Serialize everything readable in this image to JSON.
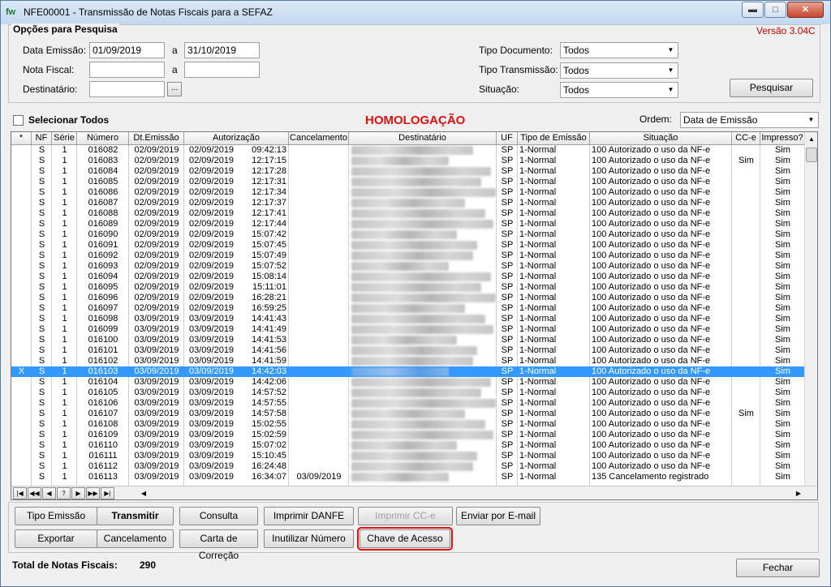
{
  "window": {
    "app_icon": "fw",
    "title": "NFE00001 - Transmissão de Notas Fiscais para a SEFAZ",
    "minimize": "▬",
    "maximize": "□",
    "close": "✕"
  },
  "options": {
    "legend": "Opções para Pesquisa",
    "version": "Versão 3.04C",
    "data_emissao_label": "Data Emissão:",
    "data_emissao_from": "01/09/2019",
    "data_emissao_to": "31/10/2019",
    "range_sep": "a",
    "nota_fiscal_label": "Nota Fiscal:",
    "nota_fiscal_from": "",
    "nota_fiscal_to": "",
    "destinatario_label": "Destinatário:",
    "destinatario_value": "",
    "lookup_button": "...",
    "tipo_documento_label": "Tipo Documento:",
    "tipo_documento_value": "Todos",
    "tipo_transmissao_label": "Tipo Transmissão:",
    "tipo_transmissao_value": "Todos",
    "situacao_label": "Situação:",
    "situacao_value": "Todos",
    "pesquisar_button": "Pesquisar"
  },
  "list_controls": {
    "select_all_label": "Selecionar Todos",
    "environment": "HOMOLOGAÇÃO",
    "ordem_label": "Ordem:",
    "ordem_value": "Data de Emissão"
  },
  "grid": {
    "columns": [
      "*",
      "NF",
      "Série",
      "Número",
      "Dt.Emissão",
      "Autorização",
      "Cancelamento",
      "Destinatário",
      "UF",
      "Tipo de Emissão",
      "Situação",
      "CC-e",
      "Impresso?"
    ],
    "rows": [
      {
        "mark": "",
        "nf": "S",
        "serie": "1",
        "numero": "016082",
        "emissao": "02/09/2019",
        "aut_data": "02/09/2019",
        "aut_hora": "09:42:13",
        "cancel": "",
        "uf": "SP",
        "tipo": "1-Normal",
        "situacao": "100 Autorizado o uso da NF-e",
        "cce": "",
        "impresso": "Sim"
      },
      {
        "mark": "",
        "nf": "S",
        "serie": "1",
        "numero": "016083",
        "emissao": "02/09/2019",
        "aut_data": "02/09/2019",
        "aut_hora": "12:17:15",
        "cancel": "",
        "uf": "SP",
        "tipo": "1-Normal",
        "situacao": "100 Autorizado o uso da NF-e",
        "cce": "Sim",
        "impresso": "Sim"
      },
      {
        "mark": "",
        "nf": "S",
        "serie": "1",
        "numero": "016084",
        "emissao": "02/09/2019",
        "aut_data": "02/09/2019",
        "aut_hora": "12:17:28",
        "cancel": "",
        "uf": "SP",
        "tipo": "1-Normal",
        "situacao": "100 Autorizado o uso da NF-e",
        "cce": "",
        "impresso": "Sim"
      },
      {
        "mark": "",
        "nf": "S",
        "serie": "1",
        "numero": "016085",
        "emissao": "02/09/2019",
        "aut_data": "02/09/2019",
        "aut_hora": "12:17:31",
        "cancel": "",
        "uf": "SP",
        "tipo": "1-Normal",
        "situacao": "100 Autorizado o uso da NF-e",
        "cce": "",
        "impresso": "Sim"
      },
      {
        "mark": "",
        "nf": "S",
        "serie": "1",
        "numero": "016086",
        "emissao": "02/09/2019",
        "aut_data": "02/09/2019",
        "aut_hora": "12:17:34",
        "cancel": "",
        "uf": "SP",
        "tipo": "1-Normal",
        "situacao": "100 Autorizado o uso da NF-e",
        "cce": "",
        "impresso": "Sim"
      },
      {
        "mark": "",
        "nf": "S",
        "serie": "1",
        "numero": "016087",
        "emissao": "02/09/2019",
        "aut_data": "02/09/2019",
        "aut_hora": "12:17:37",
        "cancel": "",
        "uf": "SP",
        "tipo": "1-Normal",
        "situacao": "100 Autorizado o uso da NF-e",
        "cce": "",
        "impresso": "Sim"
      },
      {
        "mark": "",
        "nf": "S",
        "serie": "1",
        "numero": "016088",
        "emissao": "02/09/2019",
        "aut_data": "02/09/2019",
        "aut_hora": "12:17:41",
        "cancel": "",
        "uf": "SP",
        "tipo": "1-Normal",
        "situacao": "100 Autorizado o uso da NF-e",
        "cce": "",
        "impresso": "Sim"
      },
      {
        "mark": "",
        "nf": "S",
        "serie": "1",
        "numero": "016089",
        "emissao": "02/09/2019",
        "aut_data": "02/09/2019",
        "aut_hora": "12:17:44",
        "cancel": "",
        "uf": "SP",
        "tipo": "1-Normal",
        "situacao": "100 Autorizado o uso da NF-e",
        "cce": "",
        "impresso": "Sim"
      },
      {
        "mark": "",
        "nf": "S",
        "serie": "1",
        "numero": "016090",
        "emissao": "02/09/2019",
        "aut_data": "02/09/2019",
        "aut_hora": "15:07:42",
        "cancel": "",
        "uf": "SP",
        "tipo": "1-Normal",
        "situacao": "100 Autorizado o uso da NF-e",
        "cce": "",
        "impresso": "Sim"
      },
      {
        "mark": "",
        "nf": "S",
        "serie": "1",
        "numero": "016091",
        "emissao": "02/09/2019",
        "aut_data": "02/09/2019",
        "aut_hora": "15:07:45",
        "cancel": "",
        "uf": "SP",
        "tipo": "1-Normal",
        "situacao": "100 Autorizado o uso da NF-e",
        "cce": "",
        "impresso": "Sim"
      },
      {
        "mark": "",
        "nf": "S",
        "serie": "1",
        "numero": "016092",
        "emissao": "02/09/2019",
        "aut_data": "02/09/2019",
        "aut_hora": "15:07:49",
        "cancel": "",
        "uf": "SP",
        "tipo": "1-Normal",
        "situacao": "100 Autorizado o uso da NF-e",
        "cce": "",
        "impresso": "Sim"
      },
      {
        "mark": "",
        "nf": "S",
        "serie": "1",
        "numero": "016093",
        "emissao": "02/09/2019",
        "aut_data": "02/09/2019",
        "aut_hora": "15:07:52",
        "cancel": "",
        "uf": "SP",
        "tipo": "1-Normal",
        "situacao": "100 Autorizado o uso da NF-e",
        "cce": "",
        "impresso": "Sim"
      },
      {
        "mark": "",
        "nf": "S",
        "serie": "1",
        "numero": "016094",
        "emissao": "02/09/2019",
        "aut_data": "02/09/2019",
        "aut_hora": "15:08:14",
        "cancel": "",
        "uf": "SP",
        "tipo": "1-Normal",
        "situacao": "100 Autorizado o uso da NF-e",
        "cce": "",
        "impresso": "Sim"
      },
      {
        "mark": "",
        "nf": "S",
        "serie": "1",
        "numero": "016095",
        "emissao": "02/09/2019",
        "aut_data": "02/09/2019",
        "aut_hora": "15:11:01",
        "cancel": "",
        "uf": "SP",
        "tipo": "1-Normal",
        "situacao": "100 Autorizado o uso da NF-e",
        "cce": "",
        "impresso": "Sim"
      },
      {
        "mark": "",
        "nf": "S",
        "serie": "1",
        "numero": "016096",
        "emissao": "02/09/2019",
        "aut_data": "02/09/2019",
        "aut_hora": "16:28:21",
        "cancel": "",
        "uf": "SP",
        "tipo": "1-Normal",
        "situacao": "100 Autorizado o uso da NF-e",
        "cce": "",
        "impresso": "Sim"
      },
      {
        "mark": "",
        "nf": "S",
        "serie": "1",
        "numero": "016097",
        "emissao": "02/09/2019",
        "aut_data": "02/09/2019",
        "aut_hora": "16:59:25",
        "cancel": "",
        "uf": "SP",
        "tipo": "1-Normal",
        "situacao": "100 Autorizado o uso da NF-e",
        "cce": "",
        "impresso": "Sim"
      },
      {
        "mark": "",
        "nf": "S",
        "serie": "1",
        "numero": "016098",
        "emissao": "03/09/2019",
        "aut_data": "03/09/2019",
        "aut_hora": "14:41:43",
        "cancel": "",
        "uf": "SP",
        "tipo": "1-Normal",
        "situacao": "100 Autorizado o uso da NF-e",
        "cce": "",
        "impresso": "Sim"
      },
      {
        "mark": "",
        "nf": "S",
        "serie": "1",
        "numero": "016099",
        "emissao": "03/09/2019",
        "aut_data": "03/09/2019",
        "aut_hora": "14:41:49",
        "cancel": "",
        "uf": "SP",
        "tipo": "1-Normal",
        "situacao": "100 Autorizado o uso da NF-e",
        "cce": "",
        "impresso": "Sim"
      },
      {
        "mark": "",
        "nf": "S",
        "serie": "1",
        "numero": "016100",
        "emissao": "03/09/2019",
        "aut_data": "03/09/2019",
        "aut_hora": "14:41:53",
        "cancel": "",
        "uf": "SP",
        "tipo": "1-Normal",
        "situacao": "100 Autorizado o uso da NF-e",
        "cce": "",
        "impresso": "Sim"
      },
      {
        "mark": "",
        "nf": "S",
        "serie": "1",
        "numero": "016101",
        "emissao": "03/09/2019",
        "aut_data": "03/09/2019",
        "aut_hora": "14:41:56",
        "cancel": "",
        "uf": "SP",
        "tipo": "1-Normal",
        "situacao": "100 Autorizado o uso da NF-e",
        "cce": "",
        "impresso": "Sim"
      },
      {
        "mark": "",
        "nf": "S",
        "serie": "1",
        "numero": "016102",
        "emissao": "03/09/2019",
        "aut_data": "03/09/2019",
        "aut_hora": "14:41:59",
        "cancel": "",
        "uf": "SP",
        "tipo": "1-Normal",
        "situacao": "100 Autorizado o uso da NF-e",
        "cce": "",
        "impresso": "Sim"
      },
      {
        "mark": "X",
        "nf": "S",
        "serie": "1",
        "numero": "016103",
        "emissao": "03/09/2019",
        "aut_data": "03/09/2019",
        "aut_hora": "14:42:03",
        "cancel": "",
        "uf": "SP",
        "tipo": "1-Normal",
        "situacao": "100 Autorizado o uso da NF-e",
        "cce": "",
        "impresso": "Sim",
        "selected": true
      },
      {
        "mark": "",
        "nf": "S",
        "serie": "1",
        "numero": "016104",
        "emissao": "03/09/2019",
        "aut_data": "03/09/2019",
        "aut_hora": "14:42:06",
        "cancel": "",
        "uf": "SP",
        "tipo": "1-Normal",
        "situacao": "100 Autorizado o uso da NF-e",
        "cce": "",
        "impresso": "Sim"
      },
      {
        "mark": "",
        "nf": "S",
        "serie": "1",
        "numero": "016105",
        "emissao": "03/09/2019",
        "aut_data": "03/09/2019",
        "aut_hora": "14:57:52",
        "cancel": "",
        "uf": "SP",
        "tipo": "1-Normal",
        "situacao": "100 Autorizado o uso da NF-e",
        "cce": "",
        "impresso": "Sim"
      },
      {
        "mark": "",
        "nf": "S",
        "serie": "1",
        "numero": "016106",
        "emissao": "03/09/2019",
        "aut_data": "03/09/2019",
        "aut_hora": "14:57:55",
        "cancel": "",
        "uf": "SP",
        "tipo": "1-Normal",
        "situacao": "100 Autorizado o uso da NF-e",
        "cce": "",
        "impresso": "Sim"
      },
      {
        "mark": "",
        "nf": "S",
        "serie": "1",
        "numero": "016107",
        "emissao": "03/09/2019",
        "aut_data": "03/09/2019",
        "aut_hora": "14:57:58",
        "cancel": "",
        "uf": "SP",
        "tipo": "1-Normal",
        "situacao": "100 Autorizado o uso da NF-e",
        "cce": "Sim",
        "impresso": "Sim"
      },
      {
        "mark": "",
        "nf": "S",
        "serie": "1",
        "numero": "016108",
        "emissao": "03/09/2019",
        "aut_data": "03/09/2019",
        "aut_hora": "15:02:55",
        "cancel": "",
        "uf": "SP",
        "tipo": "1-Normal",
        "situacao": "100 Autorizado o uso da NF-e",
        "cce": "",
        "impresso": "Sim"
      },
      {
        "mark": "",
        "nf": "S",
        "serie": "1",
        "numero": "016109",
        "emissao": "03/09/2019",
        "aut_data": "03/09/2019",
        "aut_hora": "15:02:59",
        "cancel": "",
        "uf": "SP",
        "tipo": "1-Normal",
        "situacao": "100 Autorizado o uso da NF-e",
        "cce": "",
        "impresso": "Sim"
      },
      {
        "mark": "",
        "nf": "S",
        "serie": "1",
        "numero": "016110",
        "emissao": "03/09/2019",
        "aut_data": "03/09/2019",
        "aut_hora": "15:07:02",
        "cancel": "",
        "uf": "SP",
        "tipo": "1-Normal",
        "situacao": "100 Autorizado o uso da NF-e",
        "cce": "",
        "impresso": "Sim"
      },
      {
        "mark": "",
        "nf": "S",
        "serie": "1",
        "numero": "016111",
        "emissao": "03/09/2019",
        "aut_data": "03/09/2019",
        "aut_hora": "15:10:45",
        "cancel": "",
        "uf": "SP",
        "tipo": "1-Normal",
        "situacao": "100 Autorizado o uso da NF-e",
        "cce": "",
        "impresso": "Sim"
      },
      {
        "mark": "",
        "nf": "S",
        "serie": "1",
        "numero": "016112",
        "emissao": "03/09/2019",
        "aut_data": "03/09/2019",
        "aut_hora": "16:24:48",
        "cancel": "",
        "uf": "SP",
        "tipo": "1-Normal",
        "situacao": "100 Autorizado o uso da NF-e",
        "cce": "",
        "impresso": "Sim"
      },
      {
        "mark": "",
        "nf": "S",
        "serie": "1",
        "numero": "016113",
        "emissao": "03/09/2019",
        "aut_data": "03/09/2019",
        "aut_hora": "16:34:07",
        "cancel": "03/09/2019",
        "uf": "SP",
        "tipo": "1-Normal",
        "situacao": "135 Cancelamento registrado",
        "cce": "",
        "impresso": "Sim"
      }
    ],
    "nav_buttons": [
      "|◀",
      "◀◀",
      "◀",
      "?",
      "▶",
      "▶▶",
      "▶|"
    ]
  },
  "actions": {
    "tipo_emissao": "Tipo Emissão",
    "transmitir": "Transmitir",
    "consulta": "Consulta",
    "imprimir_danfe": "Imprimir DANFE",
    "imprimir_cce": "Imprimir CC-e",
    "enviar_email": "Enviar por E-mail",
    "exportar": "Exportar",
    "cancelamento": "Cancelamento",
    "carta_correcao": "Carta de Correção",
    "inutilizar_numero": "Inutilizar Número",
    "chave_acesso": "Chave de Acesso"
  },
  "footer": {
    "total_label": "Total de Notas Fiscais:",
    "total_value": "290",
    "fechar_button": "Fechar"
  },
  "colors": {
    "selection": "#3399ff",
    "highlight_outline": "#e01010",
    "environment_text": "#e01010",
    "version_text": "#c00000"
  }
}
